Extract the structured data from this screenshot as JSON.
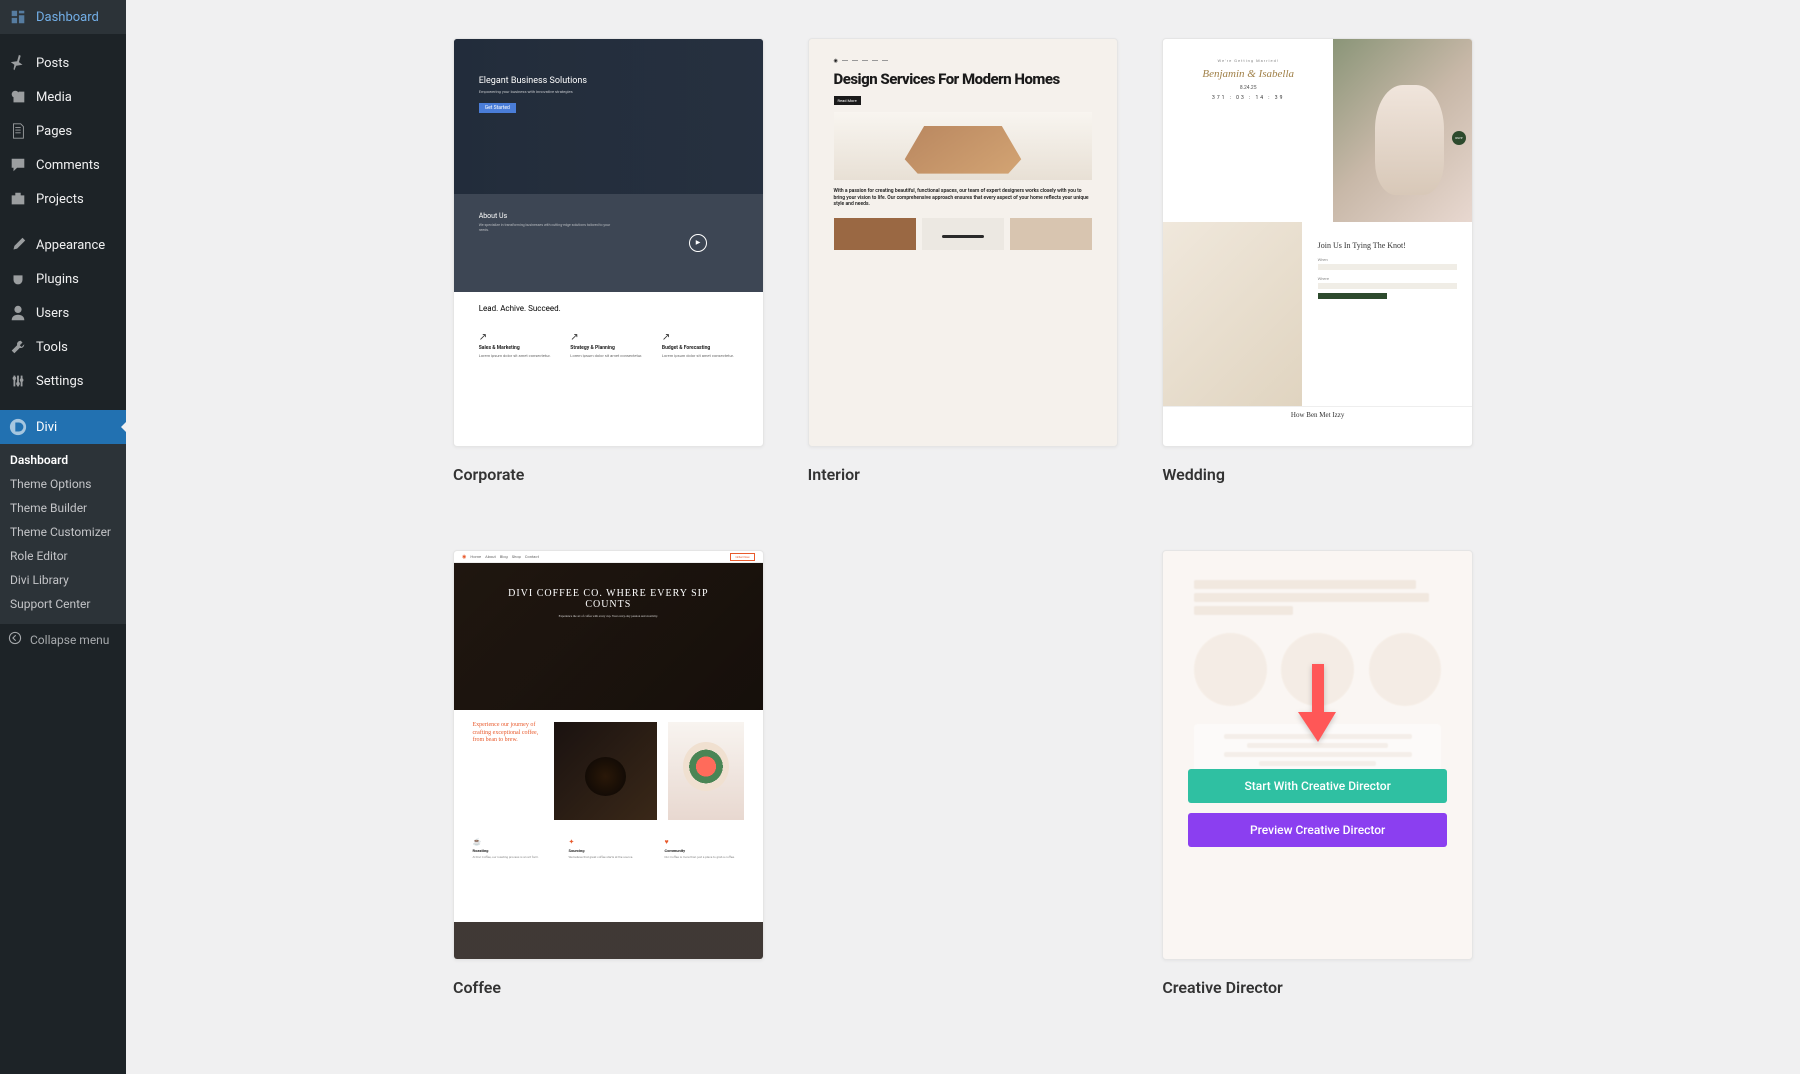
{
  "sidebar": {
    "items": [
      {
        "label": "Dashboard",
        "icon": "dashboard"
      },
      {
        "label": "Posts",
        "icon": "pin"
      },
      {
        "label": "Media",
        "icon": "media"
      },
      {
        "label": "Pages",
        "icon": "pages"
      },
      {
        "label": "Comments",
        "icon": "comment"
      },
      {
        "label": "Projects",
        "icon": "portfolio"
      },
      {
        "label": "Appearance",
        "icon": "brush"
      },
      {
        "label": "Plugins",
        "icon": "plugin"
      },
      {
        "label": "Users",
        "icon": "user"
      },
      {
        "label": "Tools",
        "icon": "tools"
      },
      {
        "label": "Settings",
        "icon": "settings"
      },
      {
        "label": "Divi",
        "icon": "divi"
      }
    ],
    "divi_submenu": [
      "Dashboard",
      "Theme Options",
      "Theme Builder",
      "Theme Customizer",
      "Role Editor",
      "Divi Library",
      "Support Center"
    ],
    "collapse_label": "Collapse menu"
  },
  "layouts": [
    {
      "id": "corporate",
      "title": "Corporate",
      "hero_text": "Elegant Business Solutions",
      "about": "About Us",
      "lead": "Lead. Achive. Succeed.",
      "cols": [
        "Sales & Marketing",
        "Strategy & Planning",
        "Budget & Forecasting"
      ]
    },
    {
      "id": "interior",
      "title": "Interior",
      "headline": "Design Services For Modern Homes",
      "tag": "Read More",
      "body": "With a passion for creating beautiful, functional spaces, our team of expert designers works closely with you to bring your vision to life. Our comprehensive approach ensures that every aspect of your home reflects your unique style and needs."
    },
    {
      "id": "wedding",
      "title": "Wedding",
      "small": "We're Getting Married!",
      "names": "Benjamin & Isabella",
      "date": "8.24.25",
      "countdown": "371 : 03 : 14 : 39",
      "rsvp": "RSVP",
      "join": "Join Us In Tying The Knot!",
      "when": "When",
      "where": "Where",
      "footer": "How Ben Met Izzy"
    },
    {
      "id": "coffee",
      "title": "Coffee",
      "nav": [
        "Home",
        "About",
        "Blog",
        "Shop",
        "Contact"
      ],
      "nav_btn": "Order Now",
      "hero": "DIVI COFFEE CO. WHERE EVERY SIP COUNTS",
      "hero_sub": "Experience the art of coffee with every cup. Your every-day passion and creativity.",
      "experience": "Experience our journey of crafting exceptional coffee, from bean to brew.",
      "cols": [
        "Roasting",
        "Sourcing",
        "Community"
      ]
    },
    {
      "id": "creative-director",
      "title": "Creative Director",
      "start_label": "Start With Creative Director",
      "preview_label": "Preview Creative Director"
    }
  ]
}
